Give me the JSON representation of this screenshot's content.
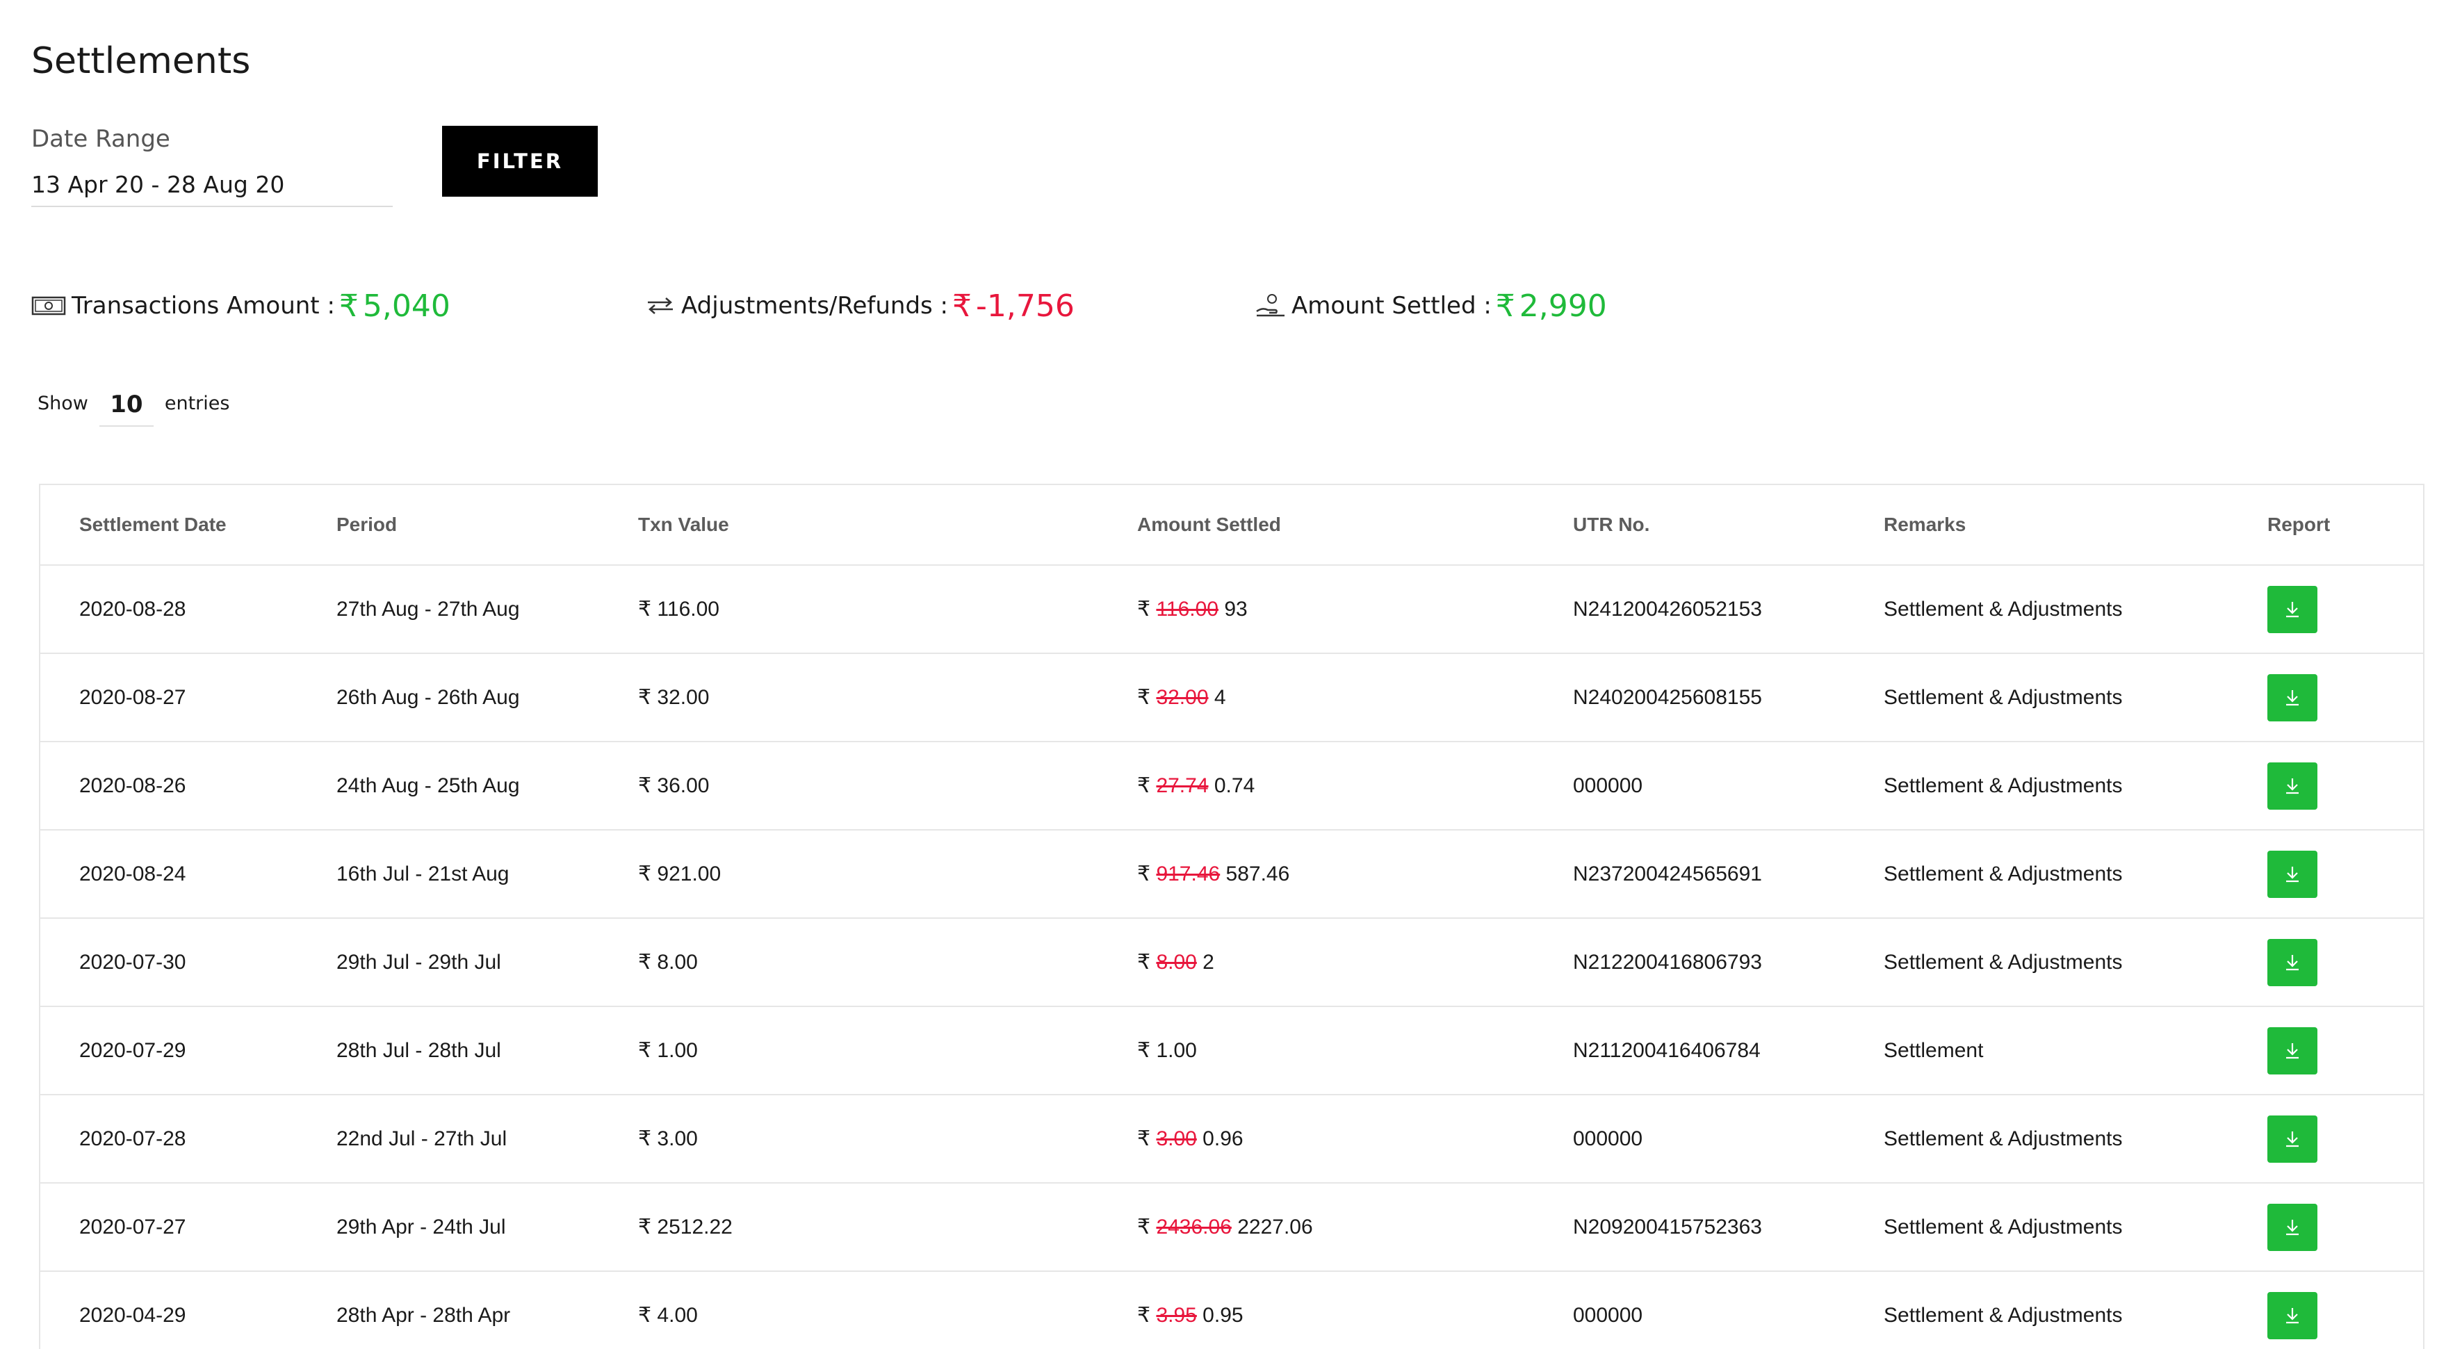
{
  "page": {
    "title": "Settlements"
  },
  "filter": {
    "date_label": "Date Range",
    "date_value": "13 Apr 20 - 28 Aug 20",
    "button_label": "FILTER"
  },
  "summary": {
    "transactions": {
      "label": "Transactions Amount :",
      "currency": "₹",
      "amount": "5,040",
      "icon": "money-bill-icon"
    },
    "adjustments": {
      "label": "Adjustments/Refunds :",
      "currency": "₹",
      "amount": "-1,756",
      "icon": "exchange-arrows-icon"
    },
    "settled": {
      "label": "Amount Settled :",
      "currency": "₹",
      "amount": "2,990",
      "icon": "hand-coin-icon"
    }
  },
  "entries": {
    "show_label": "Show",
    "count": "10",
    "entries_label": "entries"
  },
  "table": {
    "headers": [
      "Settlement Date",
      "Period",
      "Txn Value",
      "Amount Settled",
      "UTR No.",
      "Remarks",
      "Report"
    ],
    "rows": [
      {
        "date": "2020-08-28",
        "period": "27th Aug - 27th Aug",
        "txn": "₹ 116.00",
        "settled_currency": "₹",
        "settled_struck": "116.00",
        "settled": "93",
        "utr": "N241200426052153",
        "remarks": "Settlement & Adjustments"
      },
      {
        "date": "2020-08-27",
        "period": "26th Aug - 26th Aug",
        "txn": "₹ 32.00",
        "settled_currency": "₹",
        "settled_struck": "32.00",
        "settled": "4",
        "utr": "N240200425608155",
        "remarks": "Settlement & Adjustments"
      },
      {
        "date": "2020-08-26",
        "period": "24th Aug - 25th Aug",
        "txn": "₹ 36.00",
        "settled_currency": "₹",
        "settled_struck": "27.74",
        "settled": "0.74",
        "utr": "000000",
        "remarks": "Settlement & Adjustments"
      },
      {
        "date": "2020-08-24",
        "period": "16th Jul - 21st Aug",
        "txn": "₹ 921.00",
        "settled_currency": "₹",
        "settled_struck": "917.46",
        "settled": "587.46",
        "utr": "N237200424565691",
        "remarks": "Settlement & Adjustments"
      },
      {
        "date": "2020-07-30",
        "period": "29th Jul - 29th Jul",
        "txn": "₹ 8.00",
        "settled_currency": "₹",
        "settled_struck": "8.00",
        "settled": "2",
        "utr": "N212200416806793",
        "remarks": "Settlement & Adjustments"
      },
      {
        "date": "2020-07-29",
        "period": "28th Jul - 28th Jul",
        "txn": "₹ 1.00",
        "settled_currency": "₹",
        "settled_struck": "",
        "settled": "1.00",
        "utr": "N211200416406784",
        "remarks": "Settlement"
      },
      {
        "date": "2020-07-28",
        "period": "22nd Jul - 27th Jul",
        "txn": "₹ 3.00",
        "settled_currency": "₹",
        "settled_struck": "3.00",
        "settled": "0.96",
        "utr": "000000",
        "remarks": "Settlement & Adjustments"
      },
      {
        "date": "2020-07-27",
        "period": "29th Apr - 24th Jul",
        "txn": "₹ 2512.22",
        "settled_currency": "₹",
        "settled_struck": "2436.06",
        "settled": "2227.06",
        "utr": "N209200415752363",
        "remarks": "Settlement & Adjustments"
      },
      {
        "date": "2020-04-29",
        "period": "28th Apr - 28th Apr",
        "txn": "₹ 4.00",
        "settled_currency": "₹",
        "settled_struck": "3.95",
        "settled": "0.95",
        "utr": "000000",
        "remarks": "Settlement & Adjustments"
      }
    ]
  },
  "colors": {
    "positive": "#1fba3a",
    "negative": "#e8163c",
    "button_bg": "#000000",
    "download_bg": "#1fba3a"
  },
  "icons": {
    "download": "download-icon"
  }
}
